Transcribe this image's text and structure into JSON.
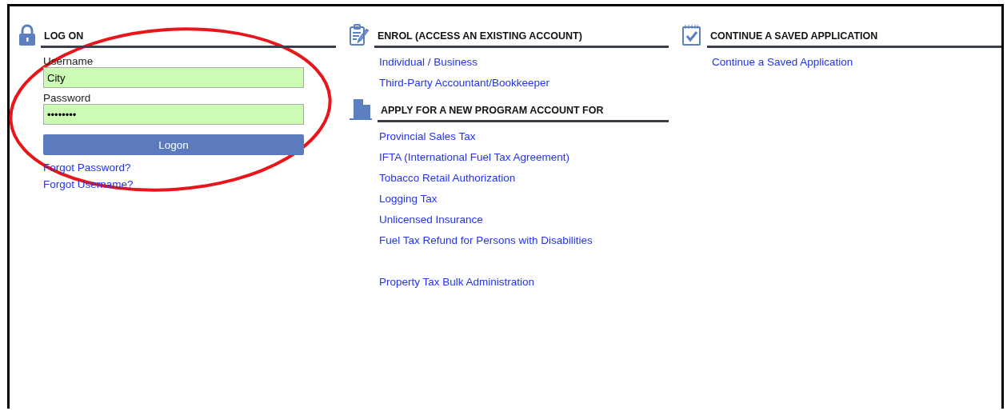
{
  "logon": {
    "title": "LOG ON",
    "fields": [
      {
        "label": "Username",
        "value": "City"
      },
      {
        "label": "Password",
        "value": "••••••••"
      }
    ],
    "button": "Logon",
    "links": [
      "Forgot Password?",
      "Forgot Username?"
    ]
  },
  "columns": [
    {
      "sections": [
        {
          "title": "ENROL (ACCESS AN EXISTING ACCOUNT)",
          "link_groups": [
            [
              "Individual / Business",
              "Third-Party Accountant/Bookkeeper"
            ]
          ]
        },
        {
          "title": "APPLY FOR A NEW PROGRAM ACCOUNT FOR",
          "link_groups": [
            [
              "Provincial Sales Tax",
              "IFTA (International Fuel Tax Agreement)",
              "Tobacco Retail Authorization",
              "Logging Tax",
              "Unlicensed Insurance",
              "Fuel Tax Refund for Persons with Disabilities"
            ],
            [
              "Property Tax Bulk Administration"
            ]
          ]
        }
      ]
    },
    {
      "sections": [
        {
          "title": "CONTINUE A SAVED APPLICATION",
          "link_groups": [
            [
              "Continue a Saved Application"
            ]
          ]
        }
      ]
    }
  ]
}
